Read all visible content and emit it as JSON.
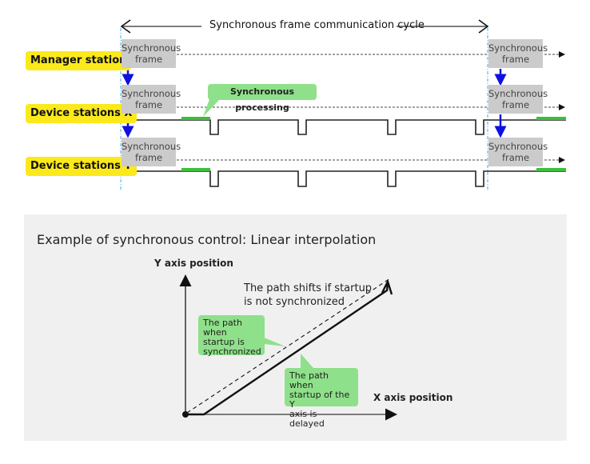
{
  "timing": {
    "cycle_label": "Synchronous frame communication cycle",
    "stations": [
      {
        "label": "Manager station"
      },
      {
        "label": "Device stations  X"
      },
      {
        "label": "Device stations  Y"
      }
    ],
    "frame_label_line1": "Synchronous",
    "frame_label_line2": "frame",
    "processing_callout": "Synchronous processing"
  },
  "example": {
    "title": "Example of synchronous control: Linear interpolation",
    "y_axis_label": "Y axis position",
    "x_axis_label": "X axis position",
    "shift_note_line1": "The path shifts if startup",
    "shift_note_line2": "is not synchronized",
    "callout_sync_line1": "The path when",
    "callout_sync_line2": "startup is",
    "callout_sync_line3": "synchronized",
    "callout_delay_line1": "The path when",
    "callout_delay_line2": "startup of the Y",
    "callout_delay_line3": "axis is delayed"
  },
  "colors": {
    "station_label": "#fbe91c",
    "frame_box": "#cbcbcb",
    "callout": "#8fe08a",
    "processing_bar": "#3cbf3c",
    "transfer_arrow": "#1010e0",
    "cycle_boundary": "#7ec8f0",
    "panel_bg": "#f0f0f0"
  }
}
